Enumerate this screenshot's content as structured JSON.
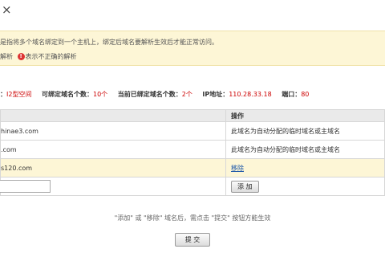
{
  "window": {
    "close_glyph": "×"
  },
  "notice": {
    "line1": "是指将多个域名绑定到一个主机上，绑定后域名要解析生效后才能正常访问。",
    "line2_a": "解析",
    "line2_b": "表示不正确的解析",
    "status_color": "#dd3333"
  },
  "account": {
    "type_label": "：",
    "type_value": "I2型空间",
    "max_label": "可绑定域名个数：",
    "max_value": "10个",
    "bound_label": "当前已绑定域名个数：",
    "bound_value": "2个",
    "ip_label": "IP地址：",
    "ip_value": "110.28.33.18",
    "port_label": "端口：",
    "port_value": "80"
  },
  "table": {
    "col_domain": "",
    "col_action": "操作",
    "rows": [
      {
        "domain": "hinae3.com",
        "note": "此域名为自动分配的临时域名或主域名"
      },
      {
        "domain": ".com",
        "note": "此域名为自动分配的临时域名或主域名"
      },
      {
        "domain": "s120.com",
        "remove_label": "移除"
      }
    ],
    "add_placeholder": "",
    "add_button": "添 加"
  },
  "hint": "\"添加\" 或 \"移除\" 域名后，需点击 \"提交\" 按钮方能生效",
  "submit_button": "提 交"
}
